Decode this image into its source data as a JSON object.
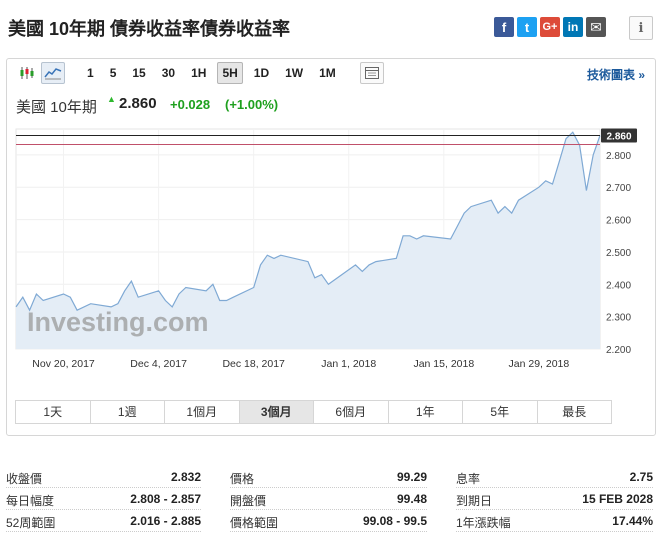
{
  "page": {
    "title": "美國 10年期 債券收益率債券收益率"
  },
  "share": {
    "items": [
      {
        "name": "facebook",
        "glyph": "f",
        "color": "#3b5998"
      },
      {
        "name": "twitter",
        "glyph": "t",
        "color": "#1da1f2"
      },
      {
        "name": "google-plus",
        "glyph": "G+",
        "color": "#dd4b39"
      },
      {
        "name": "linkedin",
        "glyph": "in",
        "color": "#0077b5"
      },
      {
        "name": "email",
        "glyph": "✉",
        "color": "#555555"
      }
    ],
    "info_glyph": "i"
  },
  "toolbar": {
    "timeframes": [
      "1",
      "5",
      "15",
      "30",
      "1H",
      "5H",
      "1D",
      "1W",
      "1M"
    ],
    "active_timeframe": "5H",
    "advanced_link": "技術圖表 »"
  },
  "quote": {
    "name": "美國 10年期",
    "arrow": "▲",
    "price": "2.860",
    "change": "+0.028",
    "change_pct": "(+1.00%)",
    "up_color": "#1ea01e"
  },
  "ranges": {
    "items": [
      "1天",
      "1週",
      "1個月",
      "3個月",
      "6個月",
      "1年",
      "5年",
      "最長"
    ],
    "active": "3個月"
  },
  "chart_data": {
    "type": "area",
    "y_ticks": [
      2.2,
      2.3,
      2.4,
      2.5,
      2.6,
      2.7,
      2.8
    ],
    "y_tick_labels": [
      "2.200",
      "2.300",
      "2.400",
      "2.500",
      "2.600",
      "2.700",
      "2.800"
    ],
    "ylim": [
      2.2,
      2.88
    ],
    "x_range": [
      "2017-11-13",
      "2018-02-07"
    ],
    "x_ticks": [
      {
        "date": "2017-11-20",
        "label": "Nov 20, 2017"
      },
      {
        "date": "2017-12-04",
        "label": "Dec 4, 2017"
      },
      {
        "date": "2017-12-18",
        "label": "Dec 18, 2017"
      },
      {
        "date": "2018-01-01",
        "label": "Jan 1, 2018"
      },
      {
        "date": "2018-01-15",
        "label": "Jan 15, 2018"
      },
      {
        "date": "2018-01-29",
        "label": "Jan 29, 2018"
      }
    ],
    "last_value": 2.86,
    "last_label": "2.860",
    "ref_line": 2.832,
    "watermark": "Investing.com",
    "line_color": "#7fa9d4",
    "fill_color": "#e4edf6",
    "points": [
      [
        "2017-11-13",
        2.33
      ],
      [
        "2017-11-14",
        2.36
      ],
      [
        "2017-11-15",
        2.32
      ],
      [
        "2017-11-16",
        2.37
      ],
      [
        "2017-11-17",
        2.35
      ],
      [
        "2017-11-20",
        2.37
      ],
      [
        "2017-11-21",
        2.36
      ],
      [
        "2017-11-22",
        2.32
      ],
      [
        "2017-11-24",
        2.34
      ],
      [
        "2017-11-27",
        2.33
      ],
      [
        "2017-11-28",
        2.34
      ],
      [
        "2017-11-29",
        2.38
      ],
      [
        "2017-11-30",
        2.41
      ],
      [
        "2017-12-01",
        2.36
      ],
      [
        "2017-12-04",
        2.38
      ],
      [
        "2017-12-05",
        2.35
      ],
      [
        "2017-12-06",
        2.33
      ],
      [
        "2017-12-07",
        2.37
      ],
      [
        "2017-12-08",
        2.39
      ],
      [
        "2017-12-11",
        2.38
      ],
      [
        "2017-12-12",
        2.4
      ],
      [
        "2017-12-13",
        2.35
      ],
      [
        "2017-12-14",
        2.35
      ],
      [
        "2017-12-15",
        2.36
      ],
      [
        "2017-12-18",
        2.39
      ],
      [
        "2017-12-19",
        2.46
      ],
      [
        "2017-12-20",
        2.49
      ],
      [
        "2017-12-21",
        2.48
      ],
      [
        "2017-12-22",
        2.49
      ],
      [
        "2017-12-26",
        2.47
      ],
      [
        "2017-12-27",
        2.42
      ],
      [
        "2017-12-28",
        2.43
      ],
      [
        "2017-12-29",
        2.4
      ],
      [
        "2018-01-02",
        2.46
      ],
      [
        "2018-01-03",
        2.44
      ],
      [
        "2018-01-04",
        2.46
      ],
      [
        "2018-01-05",
        2.47
      ],
      [
        "2018-01-08",
        2.48
      ],
      [
        "2018-01-09",
        2.55
      ],
      [
        "2018-01-10",
        2.55
      ],
      [
        "2018-01-11",
        2.54
      ],
      [
        "2018-01-12",
        2.55
      ],
      [
        "2018-01-16",
        2.54
      ],
      [
        "2018-01-17",
        2.58
      ],
      [
        "2018-01-18",
        2.62
      ],
      [
        "2018-01-19",
        2.64
      ],
      [
        "2018-01-22",
        2.66
      ],
      [
        "2018-01-23",
        2.62
      ],
      [
        "2018-01-24",
        2.64
      ],
      [
        "2018-01-25",
        2.62
      ],
      [
        "2018-01-26",
        2.66
      ],
      [
        "2018-01-29",
        2.7
      ],
      [
        "2018-01-30",
        2.72
      ],
      [
        "2018-01-31",
        2.71
      ],
      [
        "2018-02-01",
        2.78
      ],
      [
        "2018-02-02",
        2.85
      ],
      [
        "2018-02-03",
        2.87
      ],
      [
        "2018-02-04",
        2.83
      ],
      [
        "2018-02-05",
        2.69
      ],
      [
        "2018-02-06",
        2.8
      ],
      [
        "2018-02-07",
        2.86
      ]
    ]
  },
  "stats": {
    "columns": [
      [
        {
          "label": "收盤價",
          "value": "2.832"
        },
        {
          "label": "每日幅度",
          "value": "2.808 - 2.857"
        },
        {
          "label": "52周範圍",
          "value": "2.016 - 2.885"
        }
      ],
      [
        {
          "label": "價格",
          "value": "99.29"
        },
        {
          "label": "開盤價",
          "value": "99.48"
        },
        {
          "label": "價格範圍",
          "value": "99.08 - 99.5"
        }
      ],
      [
        {
          "label": "息率",
          "value": "2.75"
        },
        {
          "label": "到期日",
          "value": "15 FEB 2028"
        },
        {
          "label": "1年漲跌幅",
          "value": "17.44%"
        }
      ]
    ]
  }
}
